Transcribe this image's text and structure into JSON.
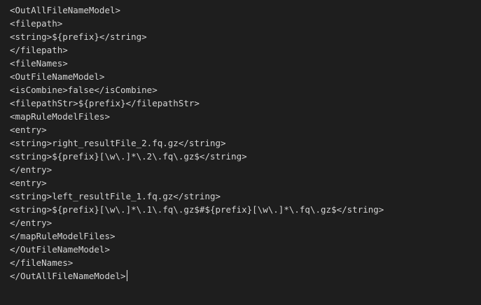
{
  "editor": {
    "lines": [
      "<OutAllFileNameModel>",
      "<filepath>",
      "<string>${prefix}</string>",
      "</filepath>",
      "<fileNames>",
      "<OutFileNameModel>",
      "<isCombine>false</isCombine>",
      "<filepathStr>${prefix}</filepathStr>",
      "<mapRuleModelFiles>",
      "<entry>",
      "<string>right_resultFile_2.fq.gz</string>",
      "<string>${prefix}[\\w\\.]*\\.2\\.fq\\.gz$</string>",
      "</entry>",
      "<entry>",
      "<string>left_resultFile_1.fq.gz</string>",
      "<string>${prefix}[\\w\\.]*\\.1\\.fq\\.gz$#${prefix}[\\w\\.]*\\.fq\\.gz$</string>",
      "</entry>",
      "</mapRuleModelFiles>",
      "</OutFileNameModel>",
      "</fileNames>",
      "</OutAllFileNameModel>"
    ],
    "colors": {
      "background": "#1e1e1e",
      "text": "#d4d4d4",
      "cursor": "#e8e8e8"
    }
  }
}
